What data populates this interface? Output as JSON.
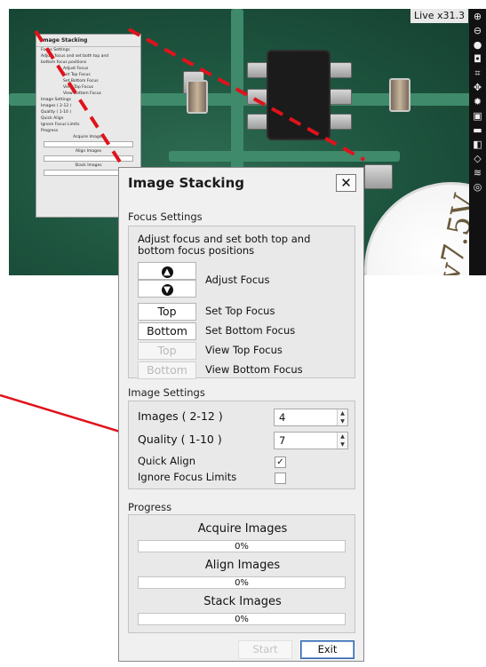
{
  "background": {
    "zoom_label": "Live x31.3",
    "toolbar_icons": [
      "zoom-in-icon",
      "zoom-out-icon",
      "record-icon",
      "camera-icon",
      "crop-icon",
      "move-icon",
      "settings-icon",
      "save-icon",
      "folder-icon",
      "compare-icon",
      "measure-icon",
      "layers-icon",
      "info-icon"
    ],
    "mini_dialog": {
      "title": "Image Stacking",
      "lines": [
        "Focus Settings",
        "Adjust focus and set both top and",
        "bottom focus positions",
        "Adjust Focus",
        "Set Top Focus",
        "Set Bottom Focus",
        "View Top Focus",
        "View Bottom Focus",
        "Image Settings",
        "Images ( 2-12 )",
        "Quality ( 1-10 )",
        "Quick Align",
        "Ignore Focus Limits",
        "Progress",
        "Acquire Images",
        "Align Images",
        "Stack Images"
      ],
      "capacitor_text": "2v7.5V"
    }
  },
  "dialog": {
    "title": "Image Stacking",
    "close_label": "✕",
    "focus": {
      "heading": "Focus Settings",
      "description": "Adjust focus and set both top and bottom focus positions",
      "adjust_label": "Adjust Focus",
      "up_icon": "arrow-up-icon",
      "down_icon": "arrow-down-icon",
      "top_button": "Top",
      "top_label": "Set Top Focus",
      "bottom_button": "Bottom",
      "bottom_label": "Set Bottom Focus",
      "view_top_button": "Top",
      "view_top_label": "View Top Focus",
      "view_bottom_button": "Bottom",
      "view_bottom_label": "View Bottom Focus"
    },
    "image": {
      "heading": "Image Settings",
      "images_label": "Images ( 2-12 )",
      "images_value": "4",
      "quality_label": "Quality ( 1-10 )",
      "quality_value": "7",
      "quick_align_label": "Quick Align",
      "quick_align_checked": true,
      "ignore_label": "Ignore Focus Limits",
      "ignore_checked": false
    },
    "progress": {
      "heading": "Progress",
      "acquire_label": "Acquire Images",
      "acquire_value": "0%",
      "acquire_fraction": 0,
      "align_label": "Align Images",
      "align_value": "0%",
      "align_fraction": 0,
      "stack_label": "Stack Images",
      "stack_value": "0%",
      "stack_fraction": 0
    },
    "start_label": "Start",
    "exit_label": "Exit"
  },
  "colors": {
    "callout": "#e0121a",
    "accent": "#2e63a8"
  }
}
